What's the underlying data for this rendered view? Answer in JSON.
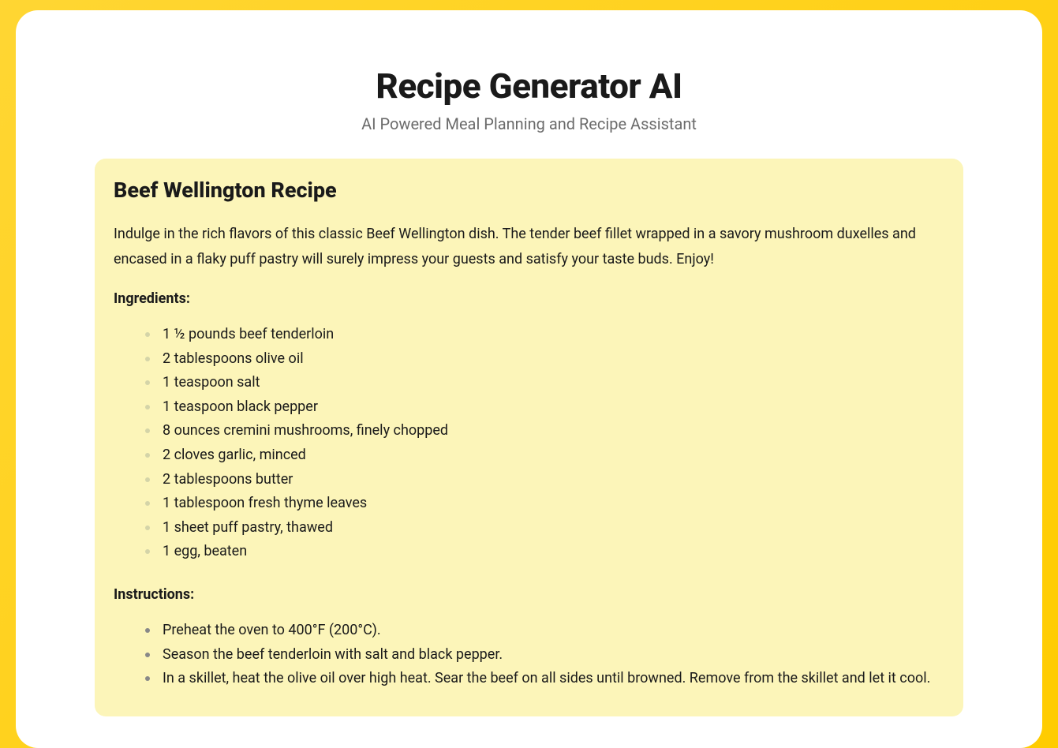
{
  "header": {
    "title": "Recipe Generator AI",
    "subtitle": "AI Powered Meal Planning and Recipe Assistant"
  },
  "recipe": {
    "title": "Beef Wellington Recipe",
    "description": "Indulge in the rich flavors of this classic Beef Wellington dish. The tender beef fillet wrapped in a savory mushroom duxelles and encased in a flaky puff pastry will surely impress your guests and satisfy your taste buds. Enjoy!",
    "ingredients_label": "Ingredients:",
    "ingredients": [
      "1 ½ pounds beef tenderloin",
      "2 tablespoons olive oil",
      "1 teaspoon salt",
      "1 teaspoon black pepper",
      "8 ounces cremini mushrooms, finely chopped",
      "2 cloves garlic, minced",
      "2 tablespoons butter",
      "1 tablespoon fresh thyme leaves",
      "1 sheet puff pastry, thawed",
      "1 egg, beaten"
    ],
    "instructions_label": "Instructions:",
    "instructions": [
      "Preheat the oven to 400°F (200°C).",
      "Season the beef tenderloin with salt and black pepper.",
      "In a skillet, heat the olive oil over high heat. Sear the beef on all sides until browned. Remove from the skillet and let it cool."
    ]
  }
}
